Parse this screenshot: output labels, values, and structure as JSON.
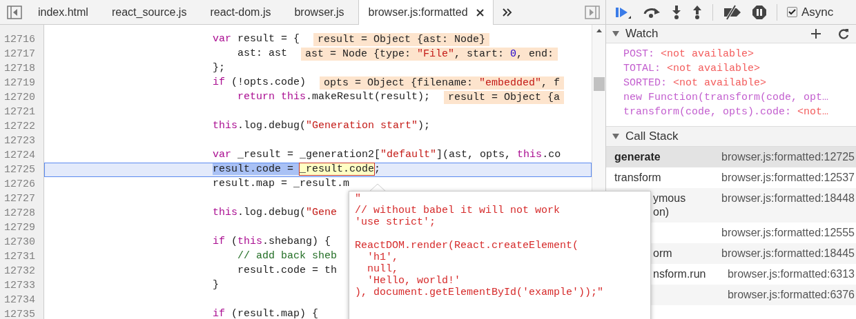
{
  "tabs": [
    {
      "label": "index.html",
      "selected": false
    },
    {
      "label": "react_source.js",
      "selected": false
    },
    {
      "label": "react-dom.js",
      "selected": false
    },
    {
      "label": "browser.js",
      "selected": false
    },
    {
      "label": "browser.js:formatted",
      "selected": true
    }
  ],
  "editor": {
    "lines": [
      {
        "number": "12716",
        "current": false,
        "tokens": [
          {
            "t": "var",
            "kind": "kw"
          },
          {
            "t": " result = {",
            "kind": "plain"
          }
        ],
        "annotation": [
          {
            "t": "result = Object {ast: Node}",
            "kind": "plain"
          }
        ]
      },
      {
        "number": "12717",
        "current": false,
        "tokens": [
          {
            "t": "    ast: ast",
            "kind": "plain"
          }
        ],
        "annotation": [
          {
            "t": "ast = Node {type: ",
            "kind": "plain"
          },
          {
            "t": "\"File\"",
            "kind": "str"
          },
          {
            "t": ", start: ",
            "kind": "plain"
          },
          {
            "t": "0",
            "kind": "num"
          },
          {
            "t": ", end:",
            "kind": "plain"
          }
        ]
      },
      {
        "number": "12718",
        "current": false,
        "tokens": [
          {
            "t": "};",
            "kind": "plain"
          }
        ]
      },
      {
        "number": "12719",
        "current": false,
        "tokens": [
          {
            "t": "if",
            "kind": "kw"
          },
          {
            "t": " (!opts.code)",
            "kind": "plain"
          }
        ],
        "annotation": [
          {
            "t": "opts = Object {filename: ",
            "kind": "plain"
          },
          {
            "t": "\"embedded\"",
            "kind": "str"
          },
          {
            "t": ", f",
            "kind": "plain"
          }
        ]
      },
      {
        "number": "12720",
        "current": false,
        "tokens": [
          {
            "t": "    return",
            "kind": "kw"
          },
          {
            "t": " this",
            "kind": "kw"
          },
          {
            "t": ".makeResult(result);",
            "kind": "plain"
          }
        ],
        "annotation": [
          {
            "t": "result = Object {a",
            "kind": "plain"
          }
        ]
      },
      {
        "number": "12721",
        "current": false
      },
      {
        "number": "12722",
        "current": false,
        "tokens": [
          {
            "t": "this",
            "kind": "kw"
          },
          {
            "t": ".log.debug(",
            "kind": "plain"
          },
          {
            "t": "\"Generation start\"",
            "kind": "str"
          },
          {
            "t": ");",
            "kind": "plain"
          }
        ]
      },
      {
        "number": "12723",
        "current": false
      },
      {
        "number": "12724",
        "current": false,
        "tokens": [
          {
            "t": "var",
            "kind": "kw"
          },
          {
            "t": " _result = _generation2[",
            "kind": "plain"
          },
          {
            "t": "\"default\"",
            "kind": "str"
          },
          {
            "t": "](ast, opts, ",
            "kind": "plain"
          },
          {
            "t": "this",
            "kind": "kw"
          },
          {
            "t": ".co",
            "kind": "plain"
          }
        ]
      },
      {
        "number": "12725",
        "current": true,
        "tokens": [
          {
            "t": "result.code = ",
            "kind": "plain",
            "selected": true,
            "hovered": false
          },
          {
            "t": "_result.code",
            "kind": "plain",
            "selected": false,
            "hovered": true
          },
          {
            "t": ";",
            "kind": "plain",
            "selected": false,
            "hovered": false
          }
        ]
      },
      {
        "number": "12726",
        "current": false,
        "tokens": [
          {
            "t": "result.map = _result.m",
            "kind": "plain"
          }
        ]
      },
      {
        "number": "12727",
        "current": false
      },
      {
        "number": "12728",
        "current": false,
        "tokens": [
          {
            "t": "this",
            "kind": "kw"
          },
          {
            "t": ".log.debug(",
            "kind": "plain"
          },
          {
            "t": "\"Gene",
            "kind": "str"
          }
        ]
      },
      {
        "number": "12729",
        "current": false
      },
      {
        "number": "12730",
        "current": false,
        "tokens": [
          {
            "t": "if",
            "kind": "kw"
          },
          {
            "t": " (",
            "kind": "plain"
          },
          {
            "t": "this",
            "kind": "kw"
          },
          {
            "t": ".shebang) {",
            "kind": "plain"
          }
        ]
      },
      {
        "number": "12731",
        "current": false,
        "tokens": [
          {
            "t": "    // add back sheb",
            "kind": "cmt"
          }
        ]
      },
      {
        "number": "12732",
        "current": false,
        "tokens": [
          {
            "t": "    result.code = th",
            "kind": "plain"
          }
        ]
      },
      {
        "number": "12733",
        "current": false,
        "tokens": [
          {
            "t": "}",
            "kind": "plain"
          }
        ]
      },
      {
        "number": "12734",
        "current": false
      },
      {
        "number": "12735",
        "current": false,
        "tokens": [
          {
            "t": "if",
            "kind": "kw"
          },
          {
            "t": " (result.map) {",
            "kind": "plain"
          }
        ]
      }
    ]
  },
  "popover": {
    "text": "\"\n// without babel it will not work\n'use strict';\n\nReactDOM.render(React.createElement(\n  'h1',\n  null,\n  'Hello, world!'\n), document.getElementById('example'));\""
  },
  "debugger": {
    "async": {
      "label": "Async",
      "checked": true
    },
    "watch": {
      "title": "Watch",
      "expanded": true,
      "items": [
        {
          "name": "POST:",
          "value": "<not available>"
        },
        {
          "name": "TOTAL:",
          "value": "<not available>"
        },
        {
          "name": "SORTED:",
          "value": "<not available>"
        },
        {
          "name": "new Function(transform(code, opt…"
        },
        {
          "name": "transform(code, opts).code:",
          "value": "<not…"
        }
      ]
    },
    "call_stack": {
      "title": "Call Stack",
      "expanded": true,
      "frames": [
        {
          "name": "generate",
          "location": "browser.js:formatted:12725",
          "selected": true,
          "covered": false
        },
        {
          "name": "transform",
          "location": "browser.js:formatted:12537",
          "selected": false,
          "covered": false
        },
        {
          "name": "ymous\non)",
          "location": "browser.js:formatted:18448",
          "selected": false,
          "covered": true
        },
        {
          "location": "browser.js:formatted:12555",
          "selected": false
        },
        {
          "name": "orm",
          "location": "browser.js:formatted:18445",
          "selected": false,
          "covered": true
        },
        {
          "name": "nsform.run",
          "location": "browser.js:formatted:6313",
          "selected": false,
          "covered": true
        },
        {
          "location": "browser.js:formatted:6376",
          "selected": false
        }
      ]
    }
  }
}
